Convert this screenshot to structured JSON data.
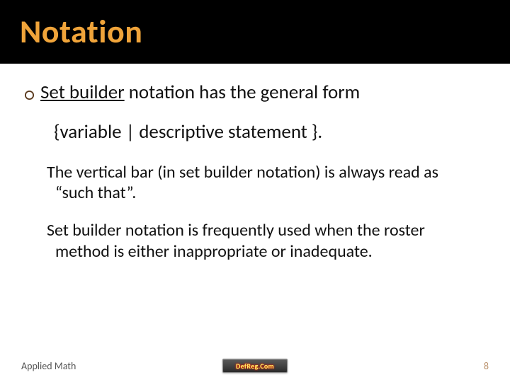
{
  "header": {
    "title": "Notation"
  },
  "body": {
    "bullet_lead": "Set builder",
    "bullet_rest": " notation has the general form",
    "formula": "{variable | descriptive statement }.",
    "para1": "The vertical bar (in set builder notation) is always read as “such that”.",
    "para2": "Set builder notation is frequently used when the roster method is either inappropriate or inadequate."
  },
  "footer": {
    "left": "Applied Math",
    "logo": "DefReg.Com",
    "page": "8"
  },
  "colors": {
    "title": "#f0a43a",
    "band": "#000000"
  }
}
